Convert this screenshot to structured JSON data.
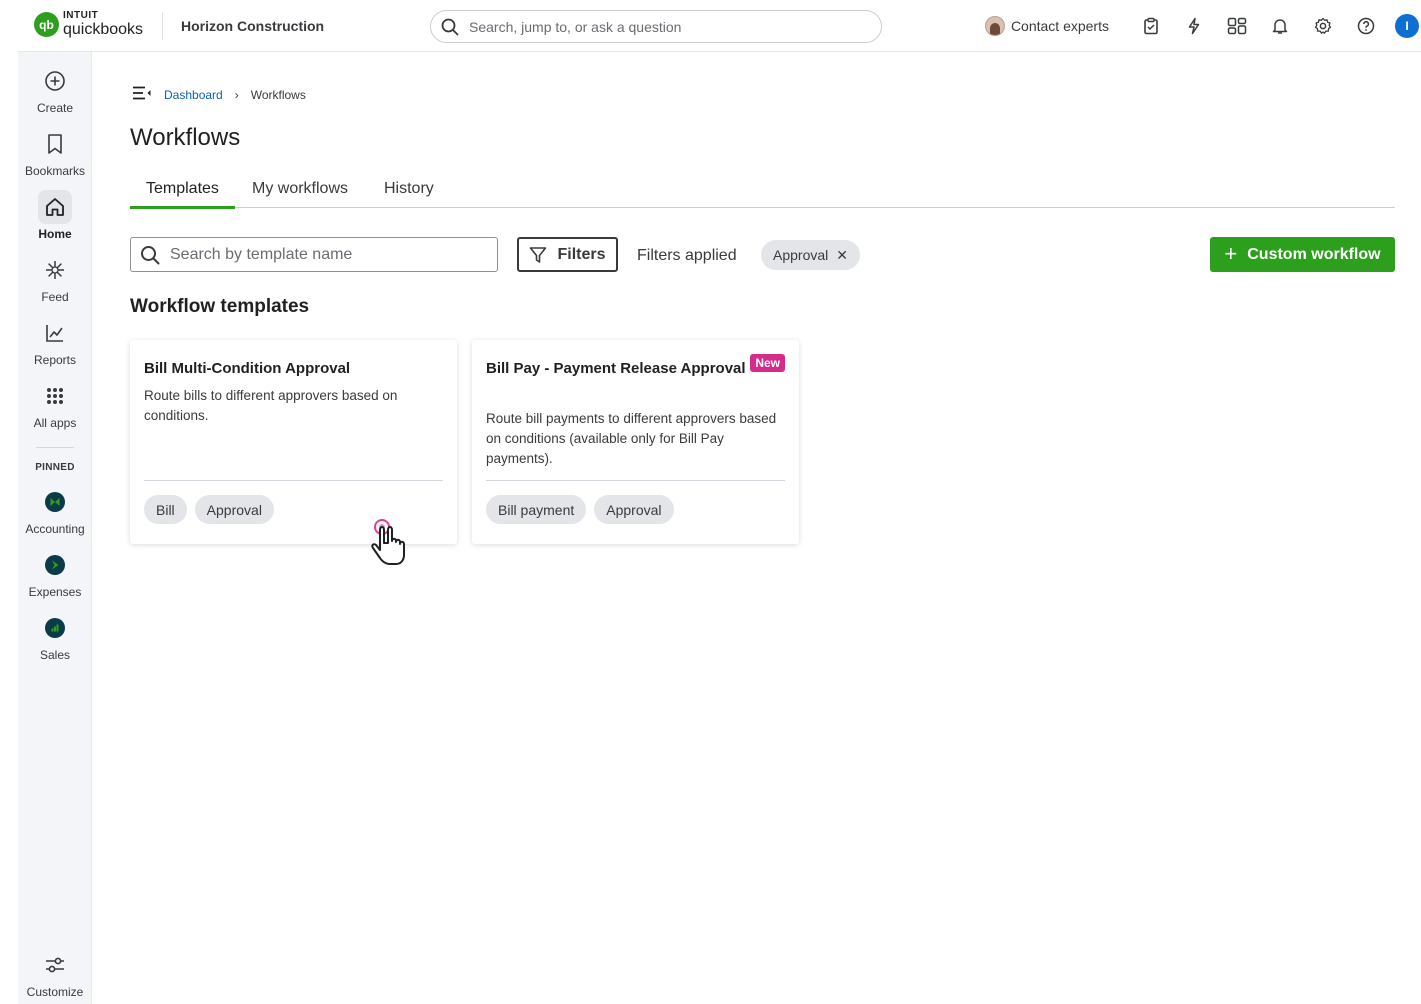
{
  "brand": {
    "intuit": "INTUIT",
    "product": "quickbooks",
    "mark": "qb"
  },
  "company": "Horizon Construction",
  "global_search": {
    "placeholder": "Search, jump to, or ask a question"
  },
  "topbar": {
    "contact_label": "Contact experts",
    "icons": [
      "clipboard-icon",
      "lightning-icon",
      "apps-switcher-icon",
      "bell-icon",
      "gear-icon",
      "help-icon"
    ],
    "user_initial": "I",
    "user_color": "#0d6fd1"
  },
  "rail": {
    "items": [
      {
        "label": "Create",
        "icon": "plus-circle-icon"
      },
      {
        "label": "Bookmarks",
        "icon": "bookmark-icon"
      },
      {
        "label": "Home",
        "icon": "home-icon"
      },
      {
        "label": "Feed",
        "icon": "sparkle-icon"
      },
      {
        "label": "Reports",
        "icon": "chart-line-icon"
      },
      {
        "label": "All apps",
        "icon": "grid-icon"
      }
    ],
    "active": "Home",
    "pinned_label": "PINNED",
    "pinned": [
      {
        "label": "Accounting",
        "icon": "accounting-app-icon"
      },
      {
        "label": "Expenses",
        "icon": "expenses-app-icon"
      },
      {
        "label": "Sales",
        "icon": "sales-app-icon"
      }
    ],
    "customize_label": "Customize"
  },
  "breadcrumb": {
    "link": "Dashboard",
    "current": "Workflows"
  },
  "page_title": "Workflows",
  "tabs": [
    {
      "label": "Templates",
      "active": true
    },
    {
      "label": "My workflows",
      "active": false
    },
    {
      "label": "History",
      "active": false
    }
  ],
  "toolbar": {
    "search_placeholder": "Search by template name",
    "filters_label": "Filters",
    "filters_applied_label": "Filters applied",
    "applied_chip": "Approval",
    "custom_button": "Custom workflow"
  },
  "section_title": "Workflow templates",
  "cards": [
    {
      "title": "Bill Multi-Condition Approval",
      "description": "Route bills to different approvers based on conditions.",
      "tags": [
        "Bill",
        "Approval"
      ],
      "badge": ""
    },
    {
      "title": "Bill Pay - Payment Release Approval",
      "description": "Route bill payments to different approvers based on conditions (available only for Bill Pay payments).",
      "tags": [
        "Bill payment",
        "Approval"
      ],
      "badge": "New"
    }
  ],
  "colors": {
    "accent_green": "#2ca01c",
    "link_blue": "#0d61b5",
    "badge_pink": "#d52b8b",
    "rail_bg": "#f4f5f8"
  }
}
